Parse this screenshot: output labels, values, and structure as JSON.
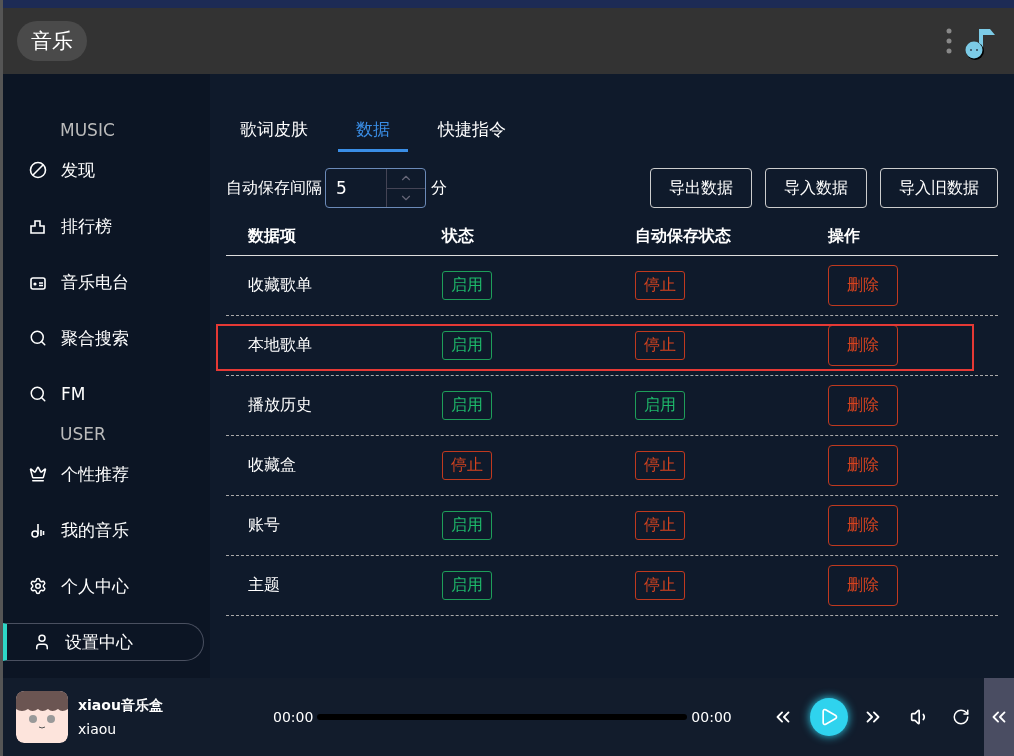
{
  "window": {
    "title": "音乐"
  },
  "sidebar": {
    "sections": [
      {
        "heading": "MUSIC",
        "items": [
          {
            "label": "发现",
            "selected": false
          },
          {
            "label": "排行榜",
            "selected": false
          },
          {
            "label": "音乐电台",
            "selected": false
          },
          {
            "label": "聚合搜索",
            "selected": false
          },
          {
            "label": "FM",
            "selected": false
          }
        ]
      },
      {
        "heading": "USER",
        "items": [
          {
            "label": "个性推荐",
            "selected": false
          },
          {
            "label": "我的音乐",
            "selected": false
          },
          {
            "label": "个人中心",
            "selected": false
          },
          {
            "label": "设置中心",
            "selected": true
          }
        ]
      }
    ]
  },
  "tabs": [
    {
      "label": "歌词皮肤",
      "selected": false
    },
    {
      "label": "数据",
      "selected": true
    },
    {
      "label": "快捷指令",
      "selected": false
    }
  ],
  "autosave": {
    "label": "自动保存间隔",
    "value": "5",
    "unit": "分"
  },
  "buttons": [
    "导出数据",
    "导入数据",
    "导入旧数据"
  ],
  "table": {
    "columns": [
      "数据项",
      "状态",
      "自动保存状态",
      "操作"
    ],
    "rows": [
      {
        "name": "收藏歌单",
        "status": {
          "label": "启用",
          "on": true
        },
        "autosave": {
          "label": "停止",
          "on": false
        },
        "action": "删除",
        "highlighted": false
      },
      {
        "name": "本地歌单",
        "status": {
          "label": "启用",
          "on": true
        },
        "autosave": {
          "label": "停止",
          "on": false
        },
        "action": "删除",
        "highlighted": true
      },
      {
        "name": "播放历史",
        "status": {
          "label": "启用",
          "on": true
        },
        "autosave": {
          "label": "启用",
          "on": true
        },
        "action": "删除",
        "highlighted": false
      },
      {
        "name": "收藏盒",
        "status": {
          "label": "停止",
          "on": false
        },
        "autosave": {
          "label": "停止",
          "on": false
        },
        "action": "删除",
        "highlighted": false
      },
      {
        "name": "账号",
        "status": {
          "label": "启用",
          "on": true
        },
        "autosave": {
          "label": "停止",
          "on": false
        },
        "action": "删除",
        "highlighted": false
      },
      {
        "name": "主题",
        "status": {
          "label": "启用",
          "on": true
        },
        "autosave": {
          "label": "停止",
          "on": false
        },
        "action": "删除",
        "highlighted": false
      }
    ]
  },
  "player": {
    "title": "xiaou音乐盒",
    "artist": "xiaou",
    "elapsed": "00:00",
    "duration": "00:00",
    "level": 0
  }
}
